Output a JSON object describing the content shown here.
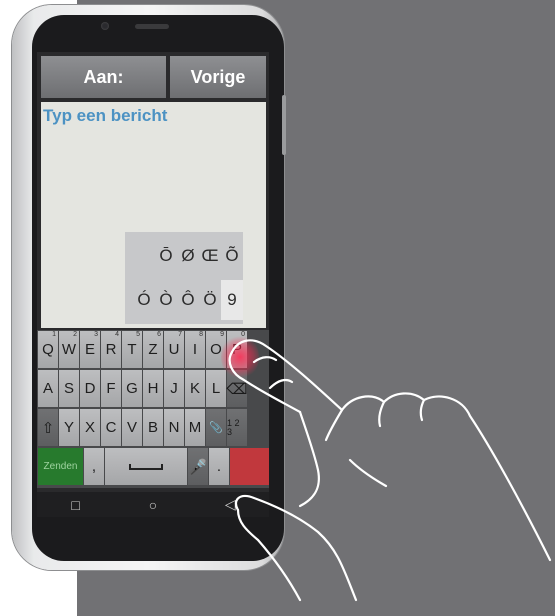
{
  "header": {
    "to_label": "Aan:",
    "prev_label": "Vorige"
  },
  "message": {
    "placeholder": "Typ een bericht"
  },
  "popup": {
    "row1": [
      "Ō",
      "Ø",
      "Œ",
      "Õ"
    ],
    "row2": [
      "Ó",
      "Ò",
      "Ô",
      "Ö",
      "9"
    ]
  },
  "keyboard": {
    "row1": [
      {
        "k": "Q",
        "n": "1"
      },
      {
        "k": "W",
        "n": "2"
      },
      {
        "k": "E",
        "n": "3"
      },
      {
        "k": "R",
        "n": "4"
      },
      {
        "k": "T",
        "n": "5"
      },
      {
        "k": "Z",
        "n": "6"
      },
      {
        "k": "U",
        "n": "7"
      },
      {
        "k": "I",
        "n": "8"
      },
      {
        "k": "O",
        "n": "9"
      },
      {
        "k": "P",
        "n": "0"
      }
    ],
    "row2": [
      "A",
      "S",
      "D",
      "F",
      "G",
      "H",
      "J",
      "K",
      "L"
    ],
    "row3": [
      "Y",
      "X",
      "C",
      "V",
      "B",
      "N",
      "M"
    ],
    "send_label": "Zenden",
    "comma": ",",
    "period": ".",
    "num_label": "1 2 3"
  },
  "icons": {
    "backspace": "backspace-icon",
    "shift": "shift-icon",
    "attach": "paperclip-icon",
    "mic": "microphone-icon",
    "space": "space-icon"
  },
  "nav": {
    "recent": "□",
    "home": "○",
    "back": "◁"
  }
}
